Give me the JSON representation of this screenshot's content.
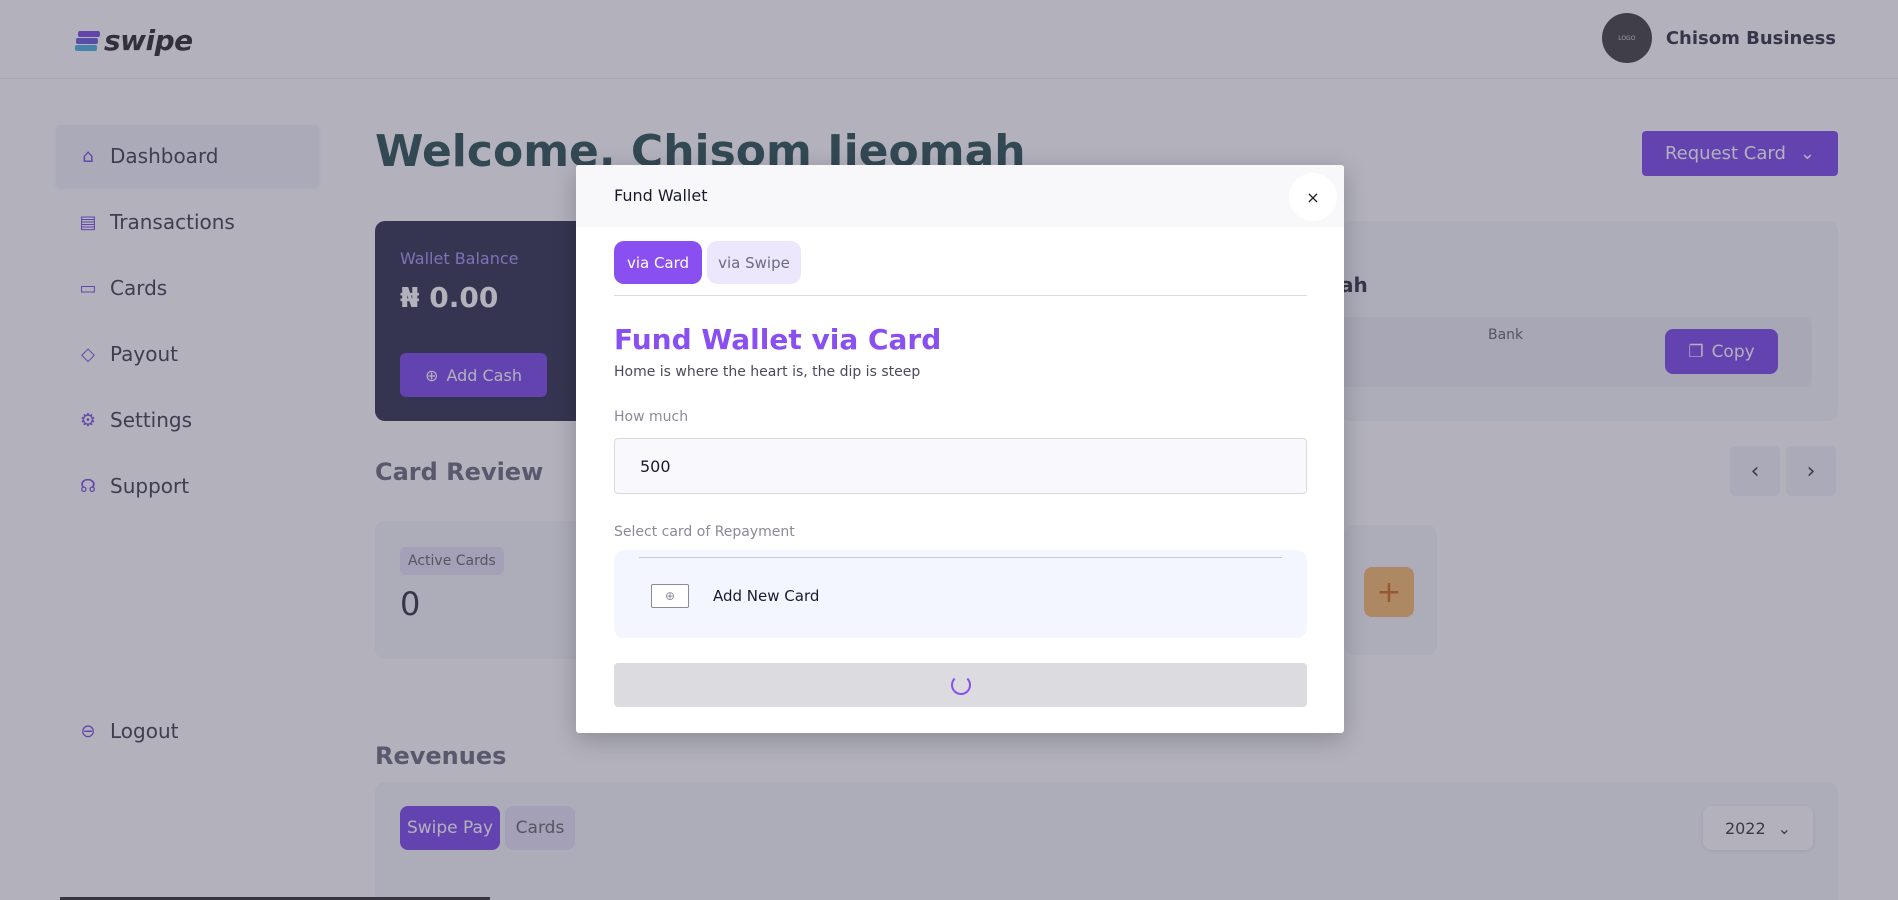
{
  "brand": {
    "name": "swipe"
  },
  "profile": {
    "avatar_text": "LOGO",
    "name": "Chisom Business"
  },
  "sidebar": {
    "items": [
      {
        "label": "Dashboard",
        "icon": "home-icon",
        "active": true
      },
      {
        "label": "Transactions",
        "icon": "clipboard-icon",
        "active": false
      },
      {
        "label": "Cards",
        "icon": "credit-card-icon",
        "active": false
      },
      {
        "label": "Payout",
        "icon": "tag-icon",
        "active": false
      },
      {
        "label": "Settings",
        "icon": "gear-icon",
        "active": false
      },
      {
        "label": "Support",
        "icon": "headset-icon",
        "active": false
      }
    ],
    "logout": "Logout"
  },
  "header": {
    "welcome": "Welcome, Chisom Ijeomah",
    "request_card": "Request Card"
  },
  "wallet": {
    "label": "Wallet Balance",
    "value": "₦ 0.00",
    "add_cash": "Add Cash"
  },
  "account": {
    "name_fragment": "ah",
    "bank_label": "Bank",
    "copy_label": "Copy"
  },
  "card_review": {
    "title": "Card Review",
    "stat_label": "Active Cards",
    "stat_value": "0"
  },
  "revenues": {
    "title": "Revenues",
    "tabs": [
      "Swipe Pay",
      "Cards"
    ],
    "year": "2022"
  },
  "modal": {
    "title": "Fund Wallet",
    "close": "×",
    "tabs": [
      {
        "label": "via Card",
        "active": true
      },
      {
        "label": "via Swipe",
        "active": false
      }
    ],
    "heading": "Fund Wallet via Card",
    "subheading": "Home is where the heart is, the dip is steep",
    "amount_label": "How much",
    "amount_value": "500",
    "card_label": "Select card of Repayment",
    "add_card": "Add New Card"
  },
  "colors": {
    "accent": "#6d35e8",
    "accent_light": "#8a4ff1",
    "wallet_bg": "#1b1b3a",
    "heading": "#133d3d"
  }
}
